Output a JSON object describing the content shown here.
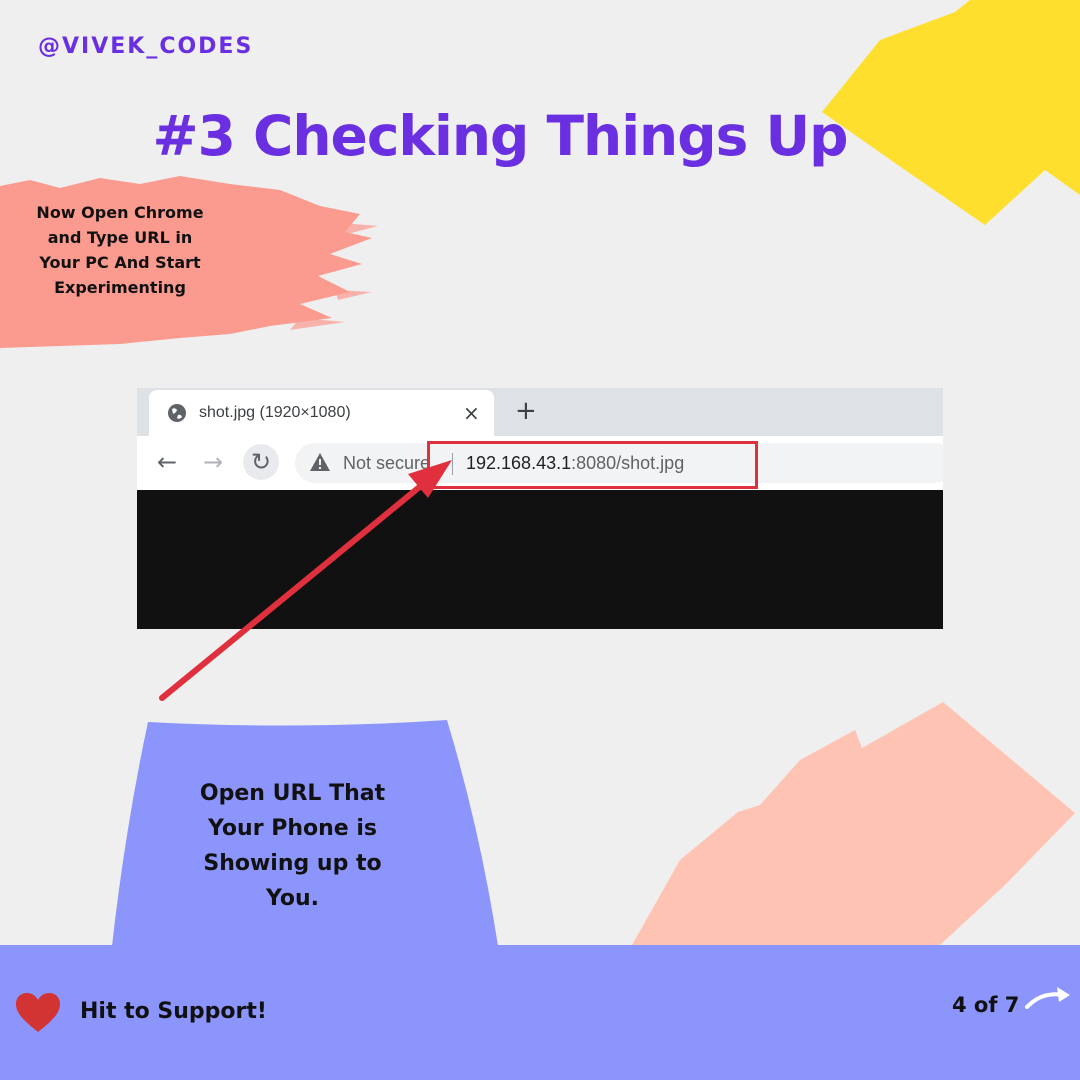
{
  "handle": "@VIVEK_CODES",
  "title": "#3 Checking Things Up",
  "side_note": "Now Open Chrome and Type URL in Your PC And Start Experimenting",
  "bottom_note": "Open URL That Your Phone is Showing up to You.",
  "browser": {
    "tab_title": "shot.jpg (1920×1080)",
    "tab_close": "×",
    "new_tab": "+",
    "back": "←",
    "forward": "→",
    "reload": "↻",
    "not_secure": "Not secure",
    "url_host": "192.168.43.1",
    "url_path": ":8080/shot.jpg",
    "icons": [
      "globe-icon",
      "close-icon",
      "plus-icon",
      "back-arrow-icon",
      "forward-arrow-icon",
      "reload-icon",
      "warning-icon"
    ]
  },
  "footer": {
    "support_text": "Hit  to Support!",
    "page_count": "4 of 7",
    "icons": [
      "heart-icon",
      "next-arrow-icon"
    ]
  },
  "colors": {
    "accent_purple": "#6a2fe0",
    "highlight_red": "#e0303e",
    "yellow": "#ffdf2e",
    "coral": "#fb9a8e",
    "salmon": "#ffc3b3",
    "periwinkle": "#8c95fc"
  }
}
